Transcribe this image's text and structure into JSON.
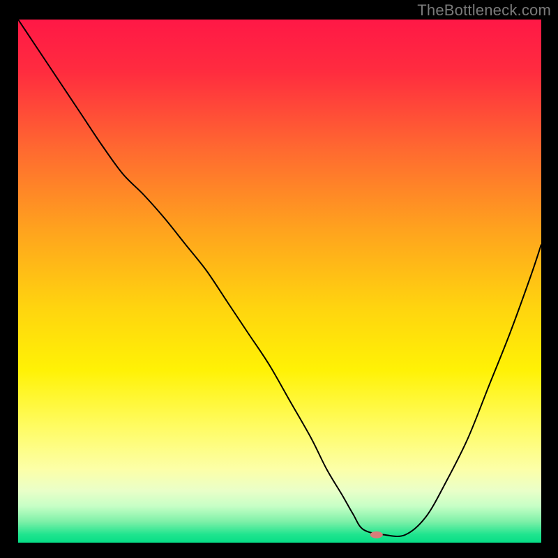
{
  "watermark": "TheBottleneck.com",
  "chart_data": {
    "type": "line",
    "title": "",
    "xlabel": "",
    "ylabel": "",
    "xlim": [
      0,
      100
    ],
    "ylim": [
      0,
      100
    ],
    "grid": false,
    "legend": false,
    "background_gradient": {
      "stops": [
        {
          "offset": 0.0,
          "color": "#ff1846"
        },
        {
          "offset": 0.1,
          "color": "#ff2c3f"
        },
        {
          "offset": 0.25,
          "color": "#ff6a30"
        },
        {
          "offset": 0.4,
          "color": "#ffa21e"
        },
        {
          "offset": 0.55,
          "color": "#ffd40f"
        },
        {
          "offset": 0.67,
          "color": "#fff205"
        },
        {
          "offset": 0.78,
          "color": "#fffc64"
        },
        {
          "offset": 0.86,
          "color": "#fcffa8"
        },
        {
          "offset": 0.9,
          "color": "#eaffc8"
        },
        {
          "offset": 0.93,
          "color": "#c7ffc6"
        },
        {
          "offset": 0.96,
          "color": "#7df0a8"
        },
        {
          "offset": 0.985,
          "color": "#1de48e"
        },
        {
          "offset": 1.0,
          "color": "#07de86"
        }
      ]
    },
    "series": [
      {
        "name": "bottleneck-curve",
        "stroke": "#000000",
        "stroke_width": 2,
        "x": [
          0.0,
          4,
          8,
          12,
          16,
          20,
          24,
          28,
          32,
          36,
          40,
          44,
          48,
          52,
          56,
          59,
          62,
          64,
          66,
          70,
          74,
          78,
          82,
          86,
          90,
          94,
          98,
          100
        ],
        "y_percent_from_top": [
          0.0,
          6,
          12,
          18,
          24,
          29.5,
          33.5,
          38,
          43,
          48,
          54,
          60,
          66,
          73,
          80,
          86,
          91,
          94.5,
          97.5,
          98.5,
          98.5,
          95,
          88,
          80,
          70,
          60,
          49,
          43
        ]
      }
    ],
    "marker": {
      "name": "optimal-marker",
      "x": 68.5,
      "y_percent_from_top": 98.5,
      "rx": 9,
      "ry": 5,
      "fill": "#d77d7a"
    }
  }
}
